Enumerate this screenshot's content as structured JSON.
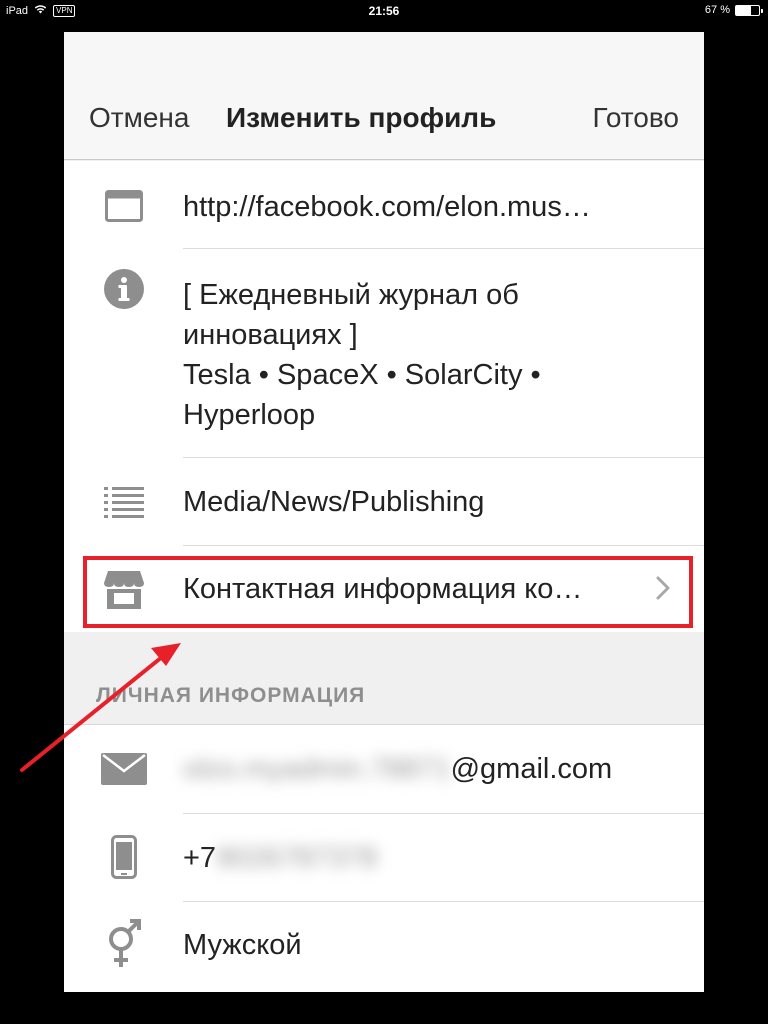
{
  "status_bar": {
    "device": "iPad",
    "vpn": "VPN",
    "time": "21:56",
    "battery_text": "67 %",
    "battery_level": 0.67
  },
  "nav": {
    "cancel": "Отмена",
    "title": "Изменить профиль",
    "done": "Готово"
  },
  "rows": {
    "website": "http://facebook.com/elon.mus…",
    "about_lines": [
      "[ Ежедневный журнал об",
      "инновациях ]",
      "Tesla • SpaceX • SolarCity •",
      "Hyperloop"
    ],
    "category": "Media/News/Publishing",
    "contact": "Контактная информация ко…"
  },
  "section_personal": "ЛИЧНАЯ ИНФОРМАЦИЯ",
  "personal": {
    "email_hidden": "olzo.myadmin.78871",
    "email_domain": "@gmail.com",
    "phone_prefix": "+7",
    "phone_hidden": "9026787378​",
    "gender": "Мужской"
  },
  "icons": {
    "website": "browser-window-icon",
    "about": "info-icon",
    "category": "list-icon",
    "contact": "storefront-icon",
    "email": "envelope-icon",
    "phone": "mobile-phone-icon",
    "gender": "gender-symbol-icon",
    "chevron": "chevron-right-icon"
  },
  "colors": {
    "icon_gray": "#8e8e8e",
    "highlight_red": "#e8202a"
  }
}
